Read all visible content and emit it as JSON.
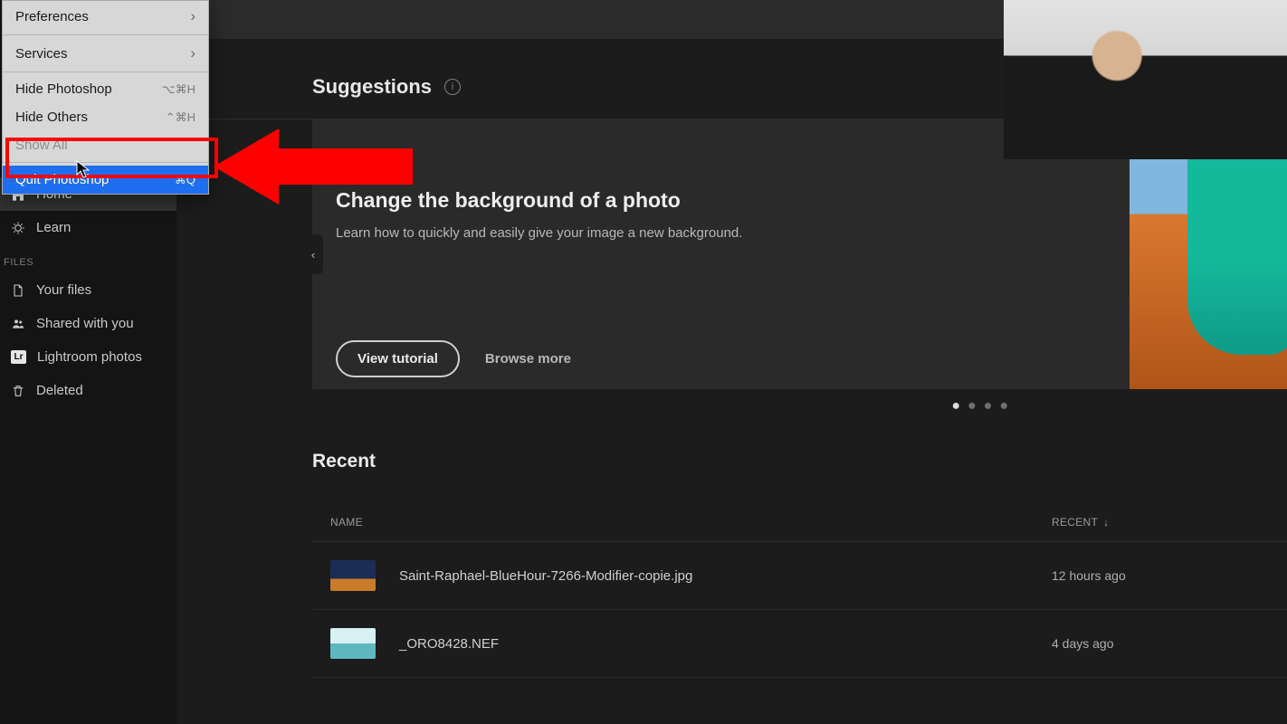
{
  "menu": {
    "items": [
      {
        "label": "Preferences",
        "submenu": true
      },
      {
        "label": "Services",
        "submenu": true
      },
      {
        "label": "Hide Photoshop",
        "shortcut": "⌥⌘H"
      },
      {
        "label": "Hide Others",
        "shortcut": "⌃⌘H"
      },
      {
        "label": "Show All",
        "dim": true
      },
      {
        "label": "Quit Photoshop",
        "shortcut": "⌘Q",
        "highlighted": true
      }
    ]
  },
  "sidebar": {
    "nav": [
      {
        "label": "Home",
        "icon": "home",
        "active": true
      },
      {
        "label": "Learn",
        "icon": "learn",
        "active": false
      }
    ],
    "files_section_label": "FILES",
    "files": [
      {
        "label": "Your files",
        "icon": "file"
      },
      {
        "label": "Shared with you",
        "icon": "people"
      },
      {
        "label": "Lightroom photos",
        "icon": "lr"
      },
      {
        "label": "Deleted",
        "icon": "trash"
      }
    ]
  },
  "suggestions": {
    "heading": "Suggestions",
    "card": {
      "title": "Change the background of a photo",
      "desc": "Learn how to quickly and easily give your image a new background.",
      "primary_btn": "View tutorial",
      "secondary_btn": "Browse more"
    },
    "page_active": 1,
    "page_count": 4
  },
  "recent": {
    "heading": "Recent",
    "columns": {
      "name": "NAME",
      "recent": "RECENT"
    },
    "rows": [
      {
        "name": "Saint-Raphael-BlueHour-7266-Modifier-copie.jpg",
        "time": "12 hours ago",
        "thumb": "city"
      },
      {
        "name": "_ORO8428.NEF",
        "time": "4 days ago",
        "thumb": "beach"
      }
    ]
  }
}
